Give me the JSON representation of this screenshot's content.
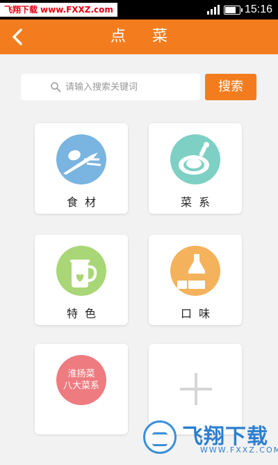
{
  "status_bar": {
    "watermark_left": "飞翔下载",
    "watermark_right": "www.FXXZ.com",
    "time": "15:16",
    "battery_level": 0.7
  },
  "header": {
    "title": "点菜"
  },
  "search": {
    "placeholder": "请输入搜索关键词",
    "button_label": "搜索"
  },
  "categories": [
    {
      "label": "食材",
      "icon": "ingredients-icon",
      "color": "#7ab4e0"
    },
    {
      "label": "菜系",
      "icon": "cuisine-icon",
      "color": "#7fd0c4"
    },
    {
      "label": "特色",
      "icon": "specialty-icon",
      "color": "#a9d677"
    },
    {
      "label": "口味",
      "icon": "taste-icon",
      "color": "#f4b25c"
    },
    {
      "label": "",
      "circle_text": [
        "淮扬菜",
        "八大菜系"
      ],
      "icon": "huaiyang-badge",
      "color": "#ee7b80"
    },
    {
      "label": "",
      "icon": "plus-icon",
      "color": "#d6d6d6"
    }
  ],
  "watermark": {
    "brand": "飞翔下载",
    "url": "WWW.FXXZ.COM"
  },
  "colors": {
    "accent": "#f37d1e",
    "background": "#f2f2f2"
  }
}
